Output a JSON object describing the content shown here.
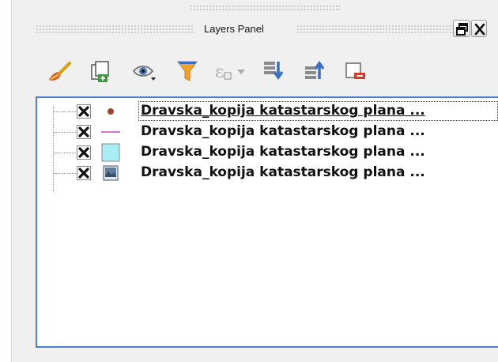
{
  "panel": {
    "title": "Layers Panel"
  },
  "window_controls": [
    {
      "name": "undock-button",
      "icon": "float-window-icon"
    },
    {
      "name": "close-button",
      "icon": "close-icon"
    }
  ],
  "toolbar": {
    "tools": [
      {
        "icon": "paintbrush-style-icon"
      },
      {
        "icon": "add-group-icon"
      },
      {
        "icon": "eye-visibility-icon"
      },
      {
        "icon": "filter-funnel-icon"
      },
      {
        "icon": "filter-expression-icon"
      },
      {
        "icon": "dropdown-arrow-icon"
      },
      {
        "icon": "expand-all-icon"
      },
      {
        "icon": "collapse-all-icon"
      },
      {
        "icon": "remove-layer-icon"
      }
    ]
  },
  "layers": [
    {
      "name": "Dravska_kopija katastarskog plana ...",
      "visible": true,
      "symbol": "point-dot-icon",
      "symbol_color": "#a0432a"
    },
    {
      "name": "Dravska_kopija katastarskog plana ...",
      "visible": true,
      "symbol": "line-icon",
      "symbol_color": "#cc44cc"
    },
    {
      "name": "Dravska_kopija katastarskog plana ...",
      "visible": true,
      "symbol": "polygon-fill-icon",
      "symbol_color": "#a8eef5"
    },
    {
      "name": "Dravska_kopija katastarskog plana ...",
      "visible": true,
      "symbol": "raster-image-icon",
      "symbol_color": "#5f7f9f"
    }
  ],
  "colors": {
    "selection_border": "#4a7fcf",
    "panel_background": "#f0f0f0"
  }
}
